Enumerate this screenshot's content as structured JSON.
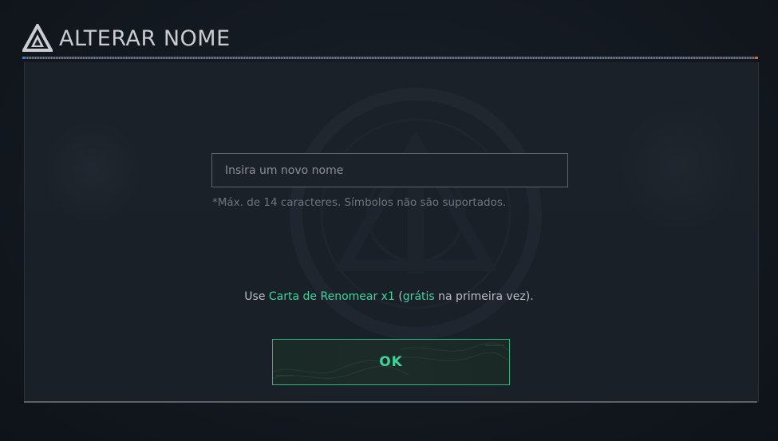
{
  "header": {
    "title": "ALTERAR NOME",
    "logo_icon": "triangle-logo-icon"
  },
  "form": {
    "name_placeholder": "Insira um novo nome",
    "name_value": "",
    "hint": "*Máx. de 14 caracteres. Símbolos não são suportados."
  },
  "rename": {
    "prefix": "Use ",
    "card": "Carta de Renomear x1",
    "middle": " (",
    "free": "grátis",
    "suffix": " na primeira vez)."
  },
  "actions": {
    "ok_label": "OK"
  },
  "colors": {
    "accent_green": "#3fd39a",
    "title_text": "#c9ccd0",
    "panel_bg": "#1b2129"
  }
}
